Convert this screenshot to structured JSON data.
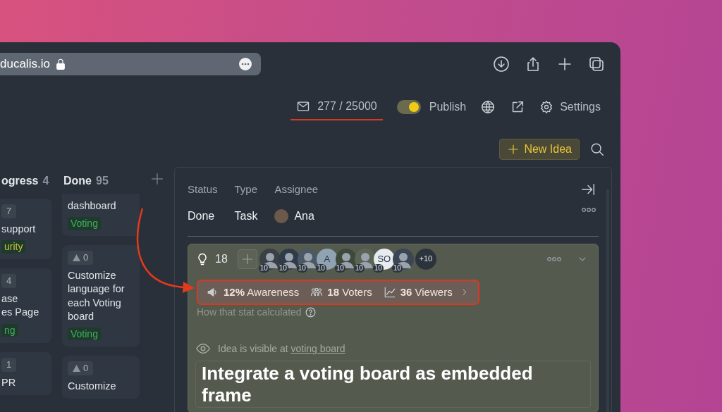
{
  "browser": {
    "url": "ducalis.io"
  },
  "header": {
    "email_count": "277 / 25000",
    "publish": {
      "label": "Publish",
      "on": true
    },
    "settings": "Settings"
  },
  "new_idea": "New Idea",
  "columns": [
    {
      "title": "ogress",
      "count": "4",
      "cards": [
        {
          "votes": "7",
          "vote_icon": false,
          "lines": [
            "support"
          ],
          "tag": {
            "label": "urity",
            "color": "#c9c23c"
          }
        },
        {
          "votes": "4",
          "vote_icon": false,
          "lines": [
            "ase",
            "es Page"
          ],
          "tag": {
            "label": "ng",
            "color": "#3fae5e"
          }
        },
        {
          "votes": "1",
          "vote_icon": false,
          "lines": [
            "PR"
          ]
        }
      ]
    },
    {
      "title": "Done",
      "count": "95",
      "cards": [
        {
          "lines": [
            "dashboard"
          ],
          "tag": {
            "label": "Voting",
            "color": "#3fae5e"
          }
        },
        {
          "votes": "0",
          "vote_icon": true,
          "lines": [
            "Customize",
            "language for",
            "each Voting",
            "board"
          ],
          "tag": {
            "label": "Voting",
            "color": "#3fae5e"
          }
        },
        {
          "votes": "0",
          "vote_icon": true,
          "lines": [
            "Customize"
          ]
        }
      ]
    }
  ],
  "detail": {
    "fields": [
      {
        "label": "Status",
        "value": "Done"
      },
      {
        "label": "Type",
        "value": "Task"
      },
      {
        "label": "Assignee",
        "value": "Ana",
        "avatar": true
      }
    ],
    "idea": {
      "ideas_count": "18",
      "voters": [
        {
          "kind": "photo",
          "score": "10"
        },
        {
          "kind": "photo",
          "score": "10"
        },
        {
          "kind": "photo",
          "score": "10"
        },
        {
          "kind": "initials",
          "initials": "A",
          "score": "10"
        },
        {
          "kind": "photo",
          "score": "10"
        },
        {
          "kind": "photo",
          "score": "10"
        },
        {
          "kind": "initials",
          "initials": "SO",
          "score": "10"
        },
        {
          "kind": "photo",
          "score": "10"
        }
      ],
      "more_voters": "+10",
      "stats": [
        {
          "kind": "awareness",
          "text": "**12%** Awareness"
        },
        {
          "kind": "voters",
          "text": "**18** Voters"
        },
        {
          "kind": "viewers",
          "text": "**36** Viewers"
        }
      ],
      "stats_help": "How that stat calculated",
      "visibility": {
        "text": "Idea is visible at",
        "link": "voting board"
      },
      "title": "Integrate a voting board as embedded frame"
    }
  }
}
